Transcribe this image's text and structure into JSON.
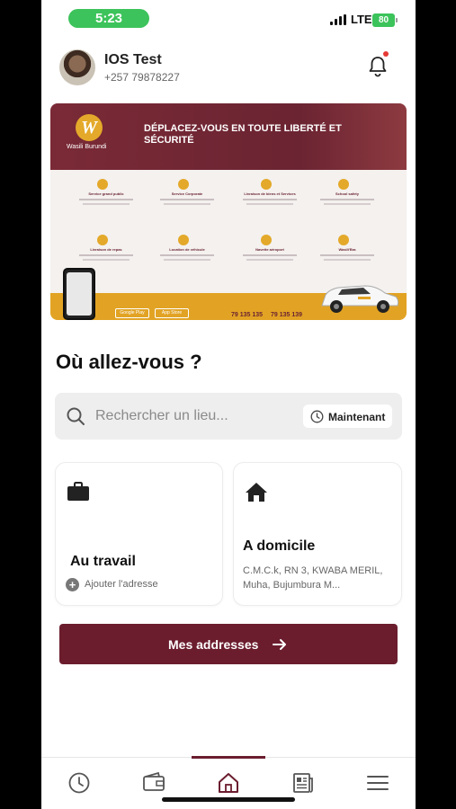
{
  "status_bar": {
    "time": "5:23",
    "network": "LTE",
    "battery": "80"
  },
  "profile": {
    "name": "IOS Test",
    "phone": "+257 79878227",
    "avatar_icon": "avatar",
    "notification_icon": "bell-icon"
  },
  "banner": {
    "logo_letter": "W",
    "logo_text": "Wasili Burundi",
    "title": "DÉPLACEZ-VOUS EN TOUTE LIBERTÉ ET SÉCURITÉ",
    "services": [
      "Service grand public",
      "Service Corporate",
      "Livraison de biens et Services",
      "School safety",
      "Livraison de repas",
      "Location de véhicule",
      "Navette aéroport",
      "Wasili'Bra"
    ],
    "store_google": "Google Play",
    "store_apple": "App Store",
    "phone_1": "79 135 135",
    "phone_2": "79 135 139"
  },
  "heading": "Où allez-vous ?",
  "search": {
    "placeholder": "Rechercher un lieu...",
    "now_label": "Maintenant"
  },
  "cards": {
    "work": {
      "title": "Au travail",
      "add_label": "Ajouter l'adresse",
      "icon": "briefcase-icon"
    },
    "home": {
      "title": "A domicile",
      "address": "C.M.C.k, RN 3, KWABA MERIL, Muha, Bujumbura M...",
      "icon": "house-icon"
    }
  },
  "addresses_button": {
    "label": "Mes addresses",
    "icon": "arrow-right-icon"
  },
  "tabbar": {
    "active": "home",
    "tabs": [
      {
        "id": "history",
        "icon": "clock-icon"
      },
      {
        "id": "wallet",
        "icon": "wallet-icon"
      },
      {
        "id": "home",
        "icon": "home-icon"
      },
      {
        "id": "news",
        "icon": "newspaper-icon"
      },
      {
        "id": "menu",
        "icon": "menu-icon"
      }
    ]
  },
  "colors": {
    "brand": "#6b1d2e",
    "accent": "#e2a324",
    "status_green": "#3cc35b"
  }
}
